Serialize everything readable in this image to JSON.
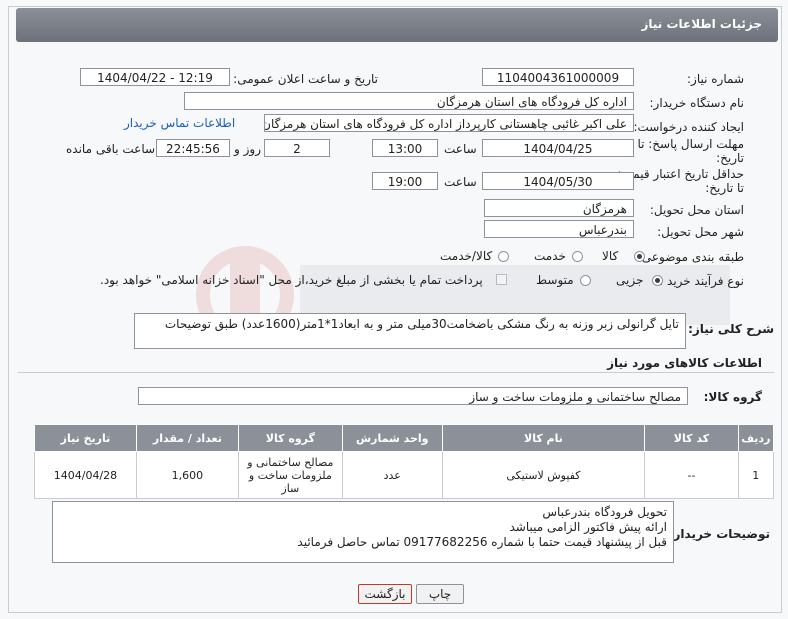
{
  "window": {
    "title": "جزئیات اطلاعات نیاز"
  },
  "form": {
    "need_number_label": "شماره نیاز:",
    "need_number": "1104004361000009",
    "announce_label": "تاریخ و ساعت اعلان عمومی:",
    "announce_value": "1404/04/22 - 12:19",
    "buyer_org_label": "نام دستگاه خریدار:",
    "buyer_org": "اداره کل فرودگاه های استان هرمزگان",
    "creator_label": "ایجاد کننده درخواست:",
    "creator": "علی اکبر غائبی چاهستانی کارپرداز اداره کل فرودگاه های استان هرمزگان",
    "contact_link": "اطلاعات تماس خریدار",
    "deadline_label_1": "مهلت ارسال پاسخ: تا",
    "deadline_label_2": "تاریخ:",
    "deadline_date": "1404/04/25",
    "time_label": "ساعت",
    "deadline_time": "13:00",
    "days_value": "2",
    "days_label": "روز و",
    "remaining_time": "22:45:56",
    "remaining_label": "ساعت باقی مانده",
    "validity_label_1": "حداقل تاریخ اعتبار قیمت:",
    "validity_label_2": "تا تاریخ:",
    "validity_date": "1404/05/30",
    "validity_time": "19:00",
    "province_label": "استان محل تحویل:",
    "province": "هرمزگان",
    "city_label": "شهر محل تحویل:",
    "city": "بندرعباس",
    "category_label": "طبقه بندی موضوعی:",
    "category_options": [
      "کالا",
      "خدمت",
      "کالا/خدمت"
    ],
    "category_selected": "کالا",
    "process_label": "نوع فرآیند خرید :",
    "process_options": [
      "جزیی",
      "متوسط"
    ],
    "process_selected": "جزیی",
    "payment_note": "پرداخت تمام یا بخشی از مبلغ خرید،از محل \"اسناد خزانه اسلامی\" خواهد بود."
  },
  "description": {
    "label": "شرح کلی نیاز:",
    "text": "تایل گرانولی زبر وزنه به رنگ مشکی باضخامت30میلی متر و به ابعاد1*1متر(1600عدد) طبق توضیحات"
  },
  "goods": {
    "section_title": "اطلاعات کالاهای مورد نیاز",
    "group_label": "گروه کالا:",
    "group_value": "مصالح ساختمانی و ملزومات ساخت و ساز",
    "columns": [
      "ردیف",
      "کد کالا",
      "نام کالا",
      "واحد شمارش",
      "گروه کالا",
      "تعداد / مقدار",
      "تاریخ نیاز"
    ],
    "rows": [
      {
        "row": "1",
        "code": "--",
        "name": "کفپوش لاستیکی",
        "unit": "عدد",
        "group": "مصالح ساختمانی و ملزومات ساخت و ساز",
        "qty": "1,600",
        "date": "1404/04/28"
      }
    ]
  },
  "buyer_notes": {
    "label": "توضیحات خریدار:",
    "lines": [
      "تحویل فرودگاه بندرعباس",
      "ارائه پیش فاکتور الزامی میباشد",
      "قبل از پیشنهاد قیمت حتما با شماره 09177682256 تماس حاصل فرمائید"
    ]
  },
  "buttons": {
    "print": "چاپ",
    "back": "بازگشت"
  },
  "colors": {
    "header_bg": "#7b8089",
    "link": "#1a5fb4",
    "back_border": "#c0392b"
  }
}
